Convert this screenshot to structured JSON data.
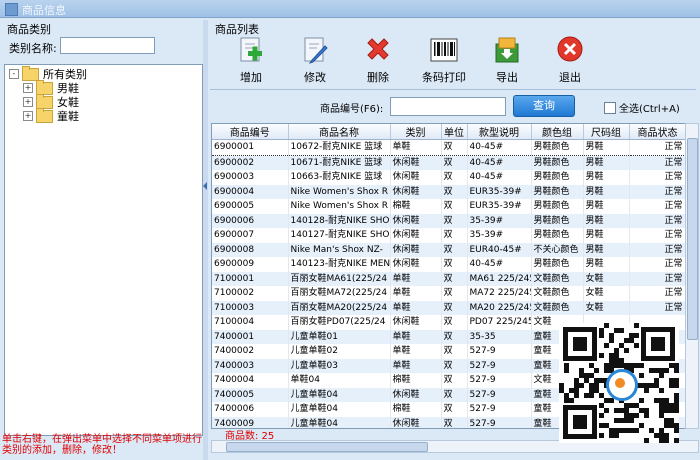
{
  "window": {
    "title": "商品信息"
  },
  "left": {
    "section_title": "商品类别",
    "category_name_label": "类别名称:",
    "category_name_value": "",
    "tree": [
      {
        "label": "所有类别",
        "expander": "-",
        "level": 0
      },
      {
        "label": "男鞋",
        "expander": "+",
        "level": 1
      },
      {
        "label": "女鞋",
        "expander": "+",
        "level": 1
      },
      {
        "label": "童鞋",
        "expander": "+",
        "level": 1
      }
    ],
    "note": "单击右键，在弹出菜单中选择不同菜单项进行类别的添加，删除，修改！"
  },
  "right": {
    "section_title": "商品列表"
  },
  "toolbar": {
    "add": {
      "label": "增加",
      "icon": "add-icon"
    },
    "edit": {
      "label": "修改",
      "icon": "edit-icon"
    },
    "delete": {
      "label": "删除",
      "icon": "delete-icon"
    },
    "barcode": {
      "label": "条码打印",
      "icon": "barcode-icon"
    },
    "export": {
      "label": "导出",
      "icon": "export-icon"
    },
    "exit": {
      "label": "退出",
      "icon": "exit-icon"
    }
  },
  "search": {
    "label": "商品编号(F6):",
    "value": "",
    "button": "查询",
    "select_all": "全选(Ctrl+A)"
  },
  "table": {
    "columns": [
      "商品编号",
      "商品名称",
      "类别",
      "单位",
      "款型说明",
      "颜色组",
      "尺码组",
      "商品状态"
    ],
    "rows": [
      [
        "6900001",
        "10672-耐克NIKE 篮球",
        "单鞋",
        "双",
        "40-45#",
        "男鞋颜色",
        "男鞋",
        "正常"
      ],
      [
        "6900002",
        "10671-耐克NIKE 篮球",
        "休闲鞋",
        "双",
        "40-45#",
        "男鞋颜色",
        "男鞋",
        "正常"
      ],
      [
        "6900003",
        "10663-耐克NIKE 篮球",
        "休闲鞋",
        "双",
        "40-45#",
        "男鞋颜色",
        "男鞋",
        "正常"
      ],
      [
        "6900004",
        "Nike Women's Shox R",
        "休闲鞋",
        "双",
        "EUR35-39#",
        "男鞋颜色",
        "男鞋",
        "正常"
      ],
      [
        "6900005",
        "Nike Women's Shox R",
        "棉鞋",
        "双",
        "EUR35-39#",
        "男鞋颜色",
        "男鞋",
        "正常"
      ],
      [
        "6900006",
        "140128-耐克NIKE SHO",
        "休闲鞋",
        "双",
        "35-39#",
        "男鞋颜色",
        "男鞋",
        "正常"
      ],
      [
        "6900007",
        "140127-耐克NIKE SHO",
        "休闲鞋",
        "双",
        "35-39#",
        "男鞋颜色",
        "男鞋",
        "正常"
      ],
      [
        "6900008",
        "Nike Man's Shox NZ-",
        "休闲鞋",
        "双",
        "EUR40-45#",
        "不关心颜色",
        "男鞋",
        "正常"
      ],
      [
        "6900009",
        "140123-耐克NIKE MEN",
        "休闲鞋",
        "双",
        "40-45#",
        "男鞋颜色",
        "男鞋",
        "正常"
      ],
      [
        "7100001",
        "百丽女鞋MA61(225/24",
        "单鞋",
        "双",
        "MA61 225/245",
        "文鞋颜色",
        "女鞋",
        "正常"
      ],
      [
        "7100002",
        "百丽女鞋MA72(225/24",
        "单鞋",
        "双",
        "MA72 225/245",
        "文鞋颜色",
        "女鞋",
        "正常"
      ],
      [
        "7100003",
        "百丽女鞋MA20(225/24",
        "单鞋",
        "双",
        "MA20 225/245",
        "文鞋颜色",
        "女鞋",
        "正常"
      ],
      [
        "7100004",
        "百丽女鞋PD07(225/24",
        "休闲鞋",
        "双",
        "PD07 225/245",
        "文鞋",
        "",
        ""
      ],
      [
        "7400001",
        "儿童单鞋01",
        "单鞋",
        "双",
        "35-35",
        "童鞋",
        "",
        ""
      ],
      [
        "7400002",
        "儿童单鞋02",
        "单鞋",
        "双",
        "527-9",
        "童鞋",
        "",
        ""
      ],
      [
        "7400003",
        "儿童单鞋03",
        "单鞋",
        "双",
        "527-9",
        "童鞋",
        "",
        ""
      ],
      [
        "7400004",
        "单鞋04",
        "棉鞋",
        "双",
        "527-9",
        "文鞋",
        "",
        ""
      ],
      [
        "7400005",
        "儿童单鞋04",
        "休闲鞋",
        "双",
        "527-9",
        "童鞋",
        "",
        ""
      ],
      [
        "7400006",
        "儿童单鞋04",
        "棉鞋",
        "双",
        "527-9",
        "童鞋",
        "",
        ""
      ],
      [
        "7400009",
        "儿童单鞋04",
        "休闲鞋",
        "双",
        "527-9",
        "童鞋",
        "",
        ""
      ]
    ]
  },
  "status": {
    "count_label": "商品数: 25"
  }
}
